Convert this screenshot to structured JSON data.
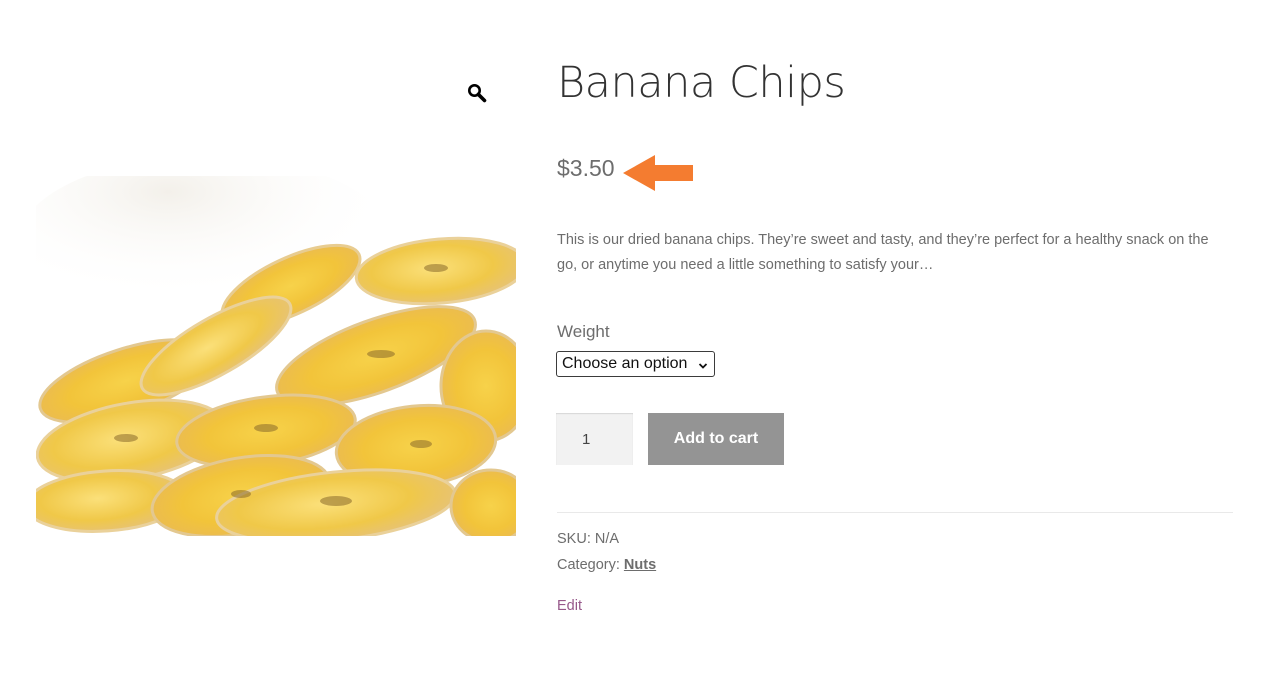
{
  "product": {
    "title": "Banana Chips",
    "price": "$3.50",
    "description": "This is our dried banana chips. They’re sweet and tasty, and they’re perfect for a healthy snack on the go, or anytime you need a little something to satisfy your…",
    "image_alt": "Banana chips"
  },
  "variation": {
    "label": "Weight",
    "selected": "Choose an option"
  },
  "cart": {
    "quantity": "1",
    "add_label": "Add to cart"
  },
  "meta": {
    "sku_label": "SKU:",
    "sku_value": "N/A",
    "category_label": "Category:",
    "category_value": "Nuts"
  },
  "admin": {
    "edit_label": "Edit"
  },
  "colors": {
    "arrow": "#f47c30",
    "button_bg": "#949494",
    "edit_link": "#96588a"
  },
  "icons": {
    "zoom": "magnifier-icon",
    "arrow": "left-arrow-icon",
    "select": "chevron-down-icon"
  }
}
